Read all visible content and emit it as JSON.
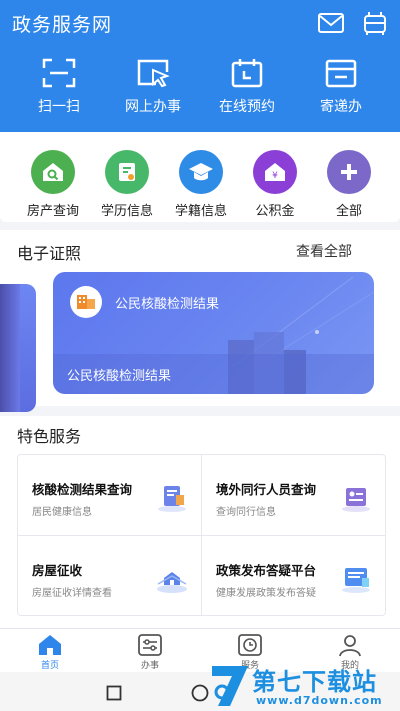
{
  "header": {
    "title": "政务服务网",
    "icons": [
      "mail-icon",
      "scan-device-icon"
    ],
    "quick_actions": [
      {
        "label": "扫一扫",
        "icon": "scan-frame-icon"
      },
      {
        "label": "网上办事",
        "icon": "cursor-window-icon"
      },
      {
        "label": "在线预约",
        "icon": "calendar-icon"
      },
      {
        "label": "寄递办",
        "icon": "mailbox-icon"
      }
    ],
    "color": "#2e86ea"
  },
  "services": [
    {
      "label": "房产查询",
      "icon": "house-search-icon",
      "color": "#4caf50"
    },
    {
      "label": "学历信息",
      "icon": "certificate-icon",
      "color": "#47b86a"
    },
    {
      "label": "学籍信息",
      "icon": "graduation-cap-icon",
      "color": "#2e8be6"
    },
    {
      "label": "公积金",
      "icon": "yen-house-icon",
      "color": "#8b3fd6"
    },
    {
      "label": "全部",
      "icon": "plus-icon",
      "color": "#7b68c9"
    }
  ],
  "ecert": {
    "title": "电子证照",
    "see_all": "查看全部",
    "card": {
      "name": "公民核酸检测结果",
      "footer": "公民核酸检测结果",
      "icon": "id-card-icon"
    }
  },
  "featured": {
    "title": "特色服务",
    "items": [
      {
        "title": "核酸检测结果查询",
        "subtitle": "居民健康信息",
        "icon": "report-icon"
      },
      {
        "title": "境外同行人员查询",
        "subtitle": "查询同行信息",
        "icon": "people-list-icon"
      },
      {
        "title": "房屋征收",
        "subtitle": "房屋征收详情查看",
        "icon": "house-scan-icon"
      },
      {
        "title": "政策发布答疑平台",
        "subtitle": "健康发展政策发布答疑",
        "icon": "policy-board-icon"
      }
    ]
  },
  "tabbar": {
    "items": [
      {
        "label": "首页",
        "icon": "home-icon",
        "active": true
      },
      {
        "label": "办事",
        "icon": "sliders-icon",
        "active": false
      },
      {
        "label": "服务",
        "icon": "clock-icon",
        "active": false
      },
      {
        "label": "我的",
        "icon": "user-icon",
        "active": false
      }
    ]
  },
  "watermark": {
    "name": "第七下载站",
    "url": "www.d7down.com"
  }
}
